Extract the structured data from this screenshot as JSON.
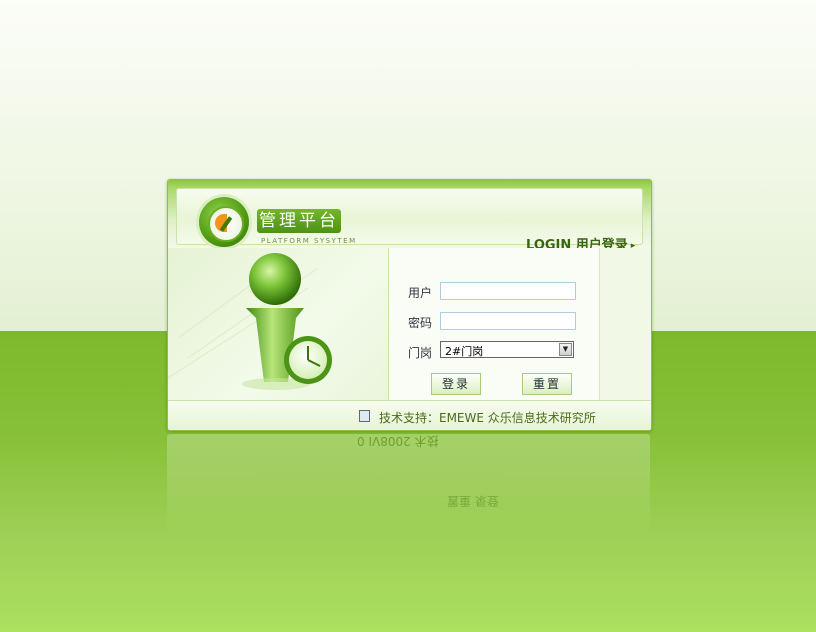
{
  "header": {
    "title": "管理平台",
    "subtitle": "PLATFORM SYSYTEM",
    "login_label": "LOGIN 用户登录",
    "login_arrow": "▸"
  },
  "form": {
    "user_label": "用户",
    "user_value": "",
    "password_label": "密码",
    "password_value": "",
    "gate_label": "门岗",
    "gate_selected": "2#门岗",
    "login_button": "登录",
    "reset_button": "重置"
  },
  "footer": {
    "support_text": "技术支持：EMEWE  众乐信息技术研究所"
  },
  "reflection": {
    "footer_text": "技术 2008VI 0",
    "buttons_text": "登录  重置"
  },
  "icons": [
    "platform-logo-icon",
    "person-clock-illustration",
    "dropdown-arrow-icon",
    "document-icon"
  ],
  "colors": {
    "brand_green": "#5a9e1a",
    "accent_orange": "#f19418"
  }
}
